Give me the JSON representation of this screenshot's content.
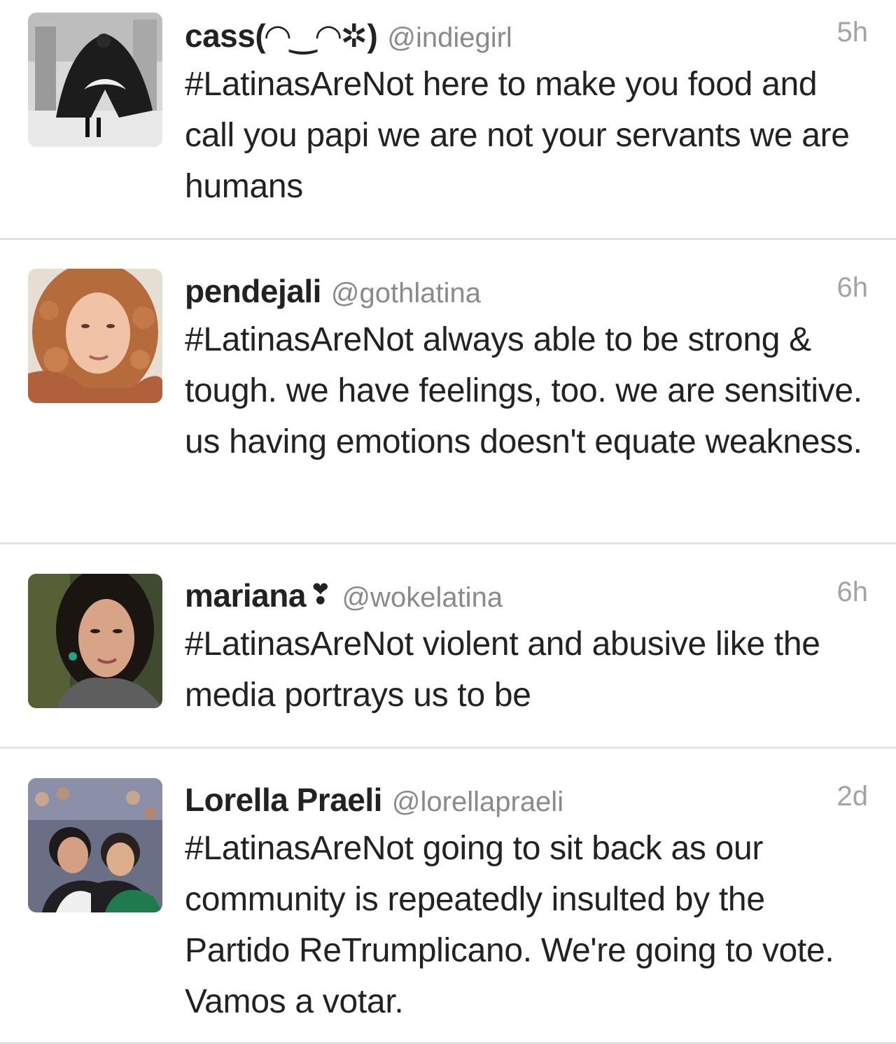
{
  "tweets": [
    {
      "display_name": "cass(◠‿◠✲)",
      "handle": "@indiegirl",
      "time": "5h",
      "text": "#LatinasAreNot here to make you food and call you papi we are not your servants we are humans"
    },
    {
      "display_name": "pendejali",
      "handle": "@gothlatina",
      "time": "6h",
      "text": "#LatinasAreNot always able to be strong & tough. we have feelings, too. we are sensitive. us having emotions doesn't equate weakness."
    },
    {
      "display_name": "mariana",
      "display_name_emoji": "❣",
      "handle": "@wokelatina",
      "time": "6h",
      "text": "#LatinasAreNot violent and abusive like the media portrays us to be"
    },
    {
      "display_name": "Lorella Praeli",
      "handle": "@lorellapraeli",
      "time": "2d",
      "text": "#LatinasAreNot going to sit back as our community is repeatedly insulted by the Partido ReTrumplicano. We're going to vote. Vamos a votar."
    }
  ]
}
